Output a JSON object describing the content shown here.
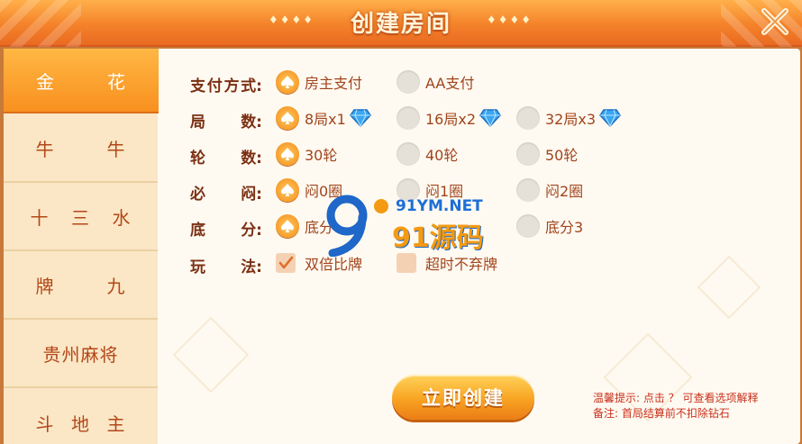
{
  "header": {
    "title": "创建房间",
    "deco_left": "♦♦♦♦",
    "deco_right": "♦♦♦♦"
  },
  "sidebar": {
    "tabs": [
      {
        "parts": [
          "金",
          "花"
        ],
        "active": true
      },
      {
        "parts": [
          "牛",
          "牛"
        ],
        "active": false
      },
      {
        "parts": [
          "十",
          "三",
          "水"
        ],
        "active": false
      },
      {
        "parts": [
          "牌",
          "九"
        ],
        "active": false
      },
      {
        "parts": [
          "贵州麻将"
        ],
        "active": false
      },
      {
        "parts": [
          "斗",
          "地",
          "主"
        ],
        "active": false
      }
    ]
  },
  "options": {
    "payment": {
      "label": [
        "支",
        "付",
        "方",
        "式:"
      ],
      "choices": [
        "房主支付",
        "AA支付"
      ],
      "selected": 0
    },
    "rounds": {
      "label": [
        "局",
        "数:"
      ],
      "choices": [
        "8局x1",
        "16局x2",
        "32局x3"
      ],
      "selected": 0
    },
    "turns": {
      "label": [
        "轮",
        "数:"
      ],
      "choices": [
        "30轮",
        "40轮",
        "50轮"
      ],
      "selected": 0
    },
    "blind": {
      "label": [
        "必",
        "闷:"
      ],
      "choices": [
        "闷0圈",
        "闷1圈",
        "闷2圈"
      ],
      "selected": 0
    },
    "base": {
      "label": [
        "底",
        "分:"
      ],
      "choices": [
        "底分",
        "底分3"
      ],
      "selected": 0
    },
    "rules": {
      "label": [
        "玩",
        "法:"
      ],
      "choices": [
        "双倍比牌",
        "超时不弃牌"
      ],
      "checked": [
        true,
        false
      ]
    }
  },
  "watermark": {
    "url": "91YM.NET",
    "name": "91源码"
  },
  "create_button": "立即创建",
  "tips": {
    "line1": "温馨提示: 点击 ？ 可查看选项解释",
    "line2": "备注: 首局结算前不扣除钻石"
  },
  "colors": {
    "accent": "#f8901f",
    "header": "#f4822a",
    "label": "#7a2f13",
    "option_text": "#a0441c",
    "tip": "#c8301c"
  }
}
